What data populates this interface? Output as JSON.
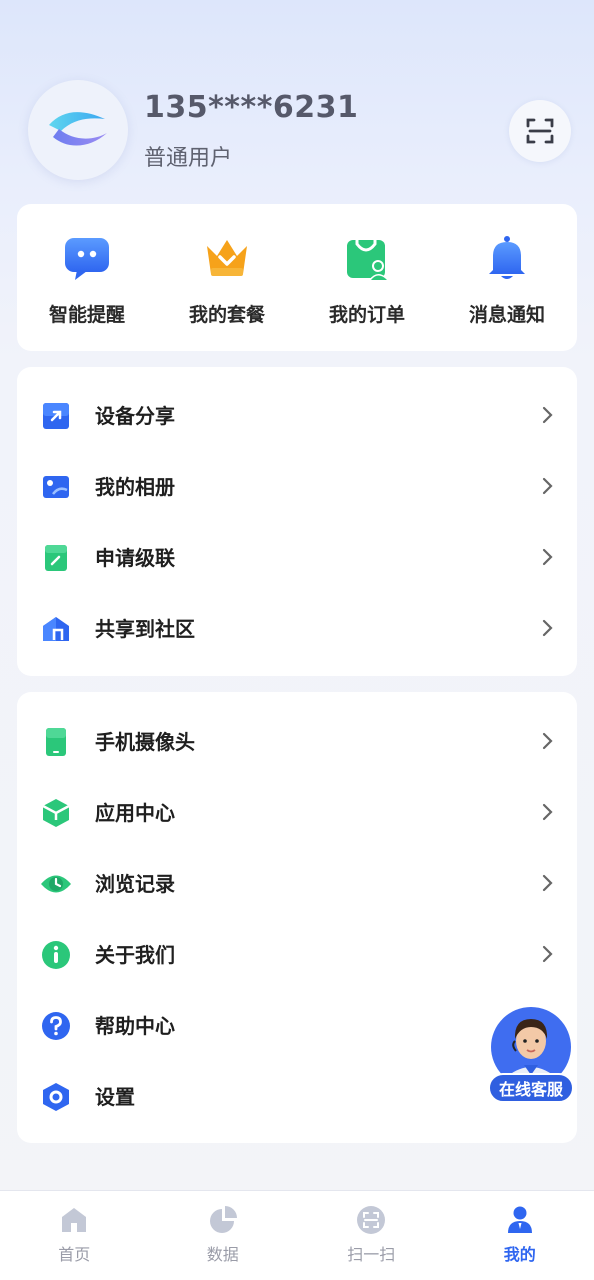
{
  "profile": {
    "phone": "135****6231",
    "user_type": "普通用户"
  },
  "quick_actions": [
    {
      "label": "智能提醒",
      "icon": "chat-bubble-icon"
    },
    {
      "label": "我的套餐",
      "icon": "crown-icon"
    },
    {
      "label": "我的订单",
      "icon": "shopping-bag-icon"
    },
    {
      "label": "消息通知",
      "icon": "bell-icon"
    }
  ],
  "menu_group_1": [
    {
      "label": "设备分享",
      "icon": "share-arrow-icon"
    },
    {
      "label": "我的相册",
      "icon": "photo-album-icon"
    },
    {
      "label": "申请级联",
      "icon": "edit-doc-icon"
    },
    {
      "label": "共享到社区",
      "icon": "community-icon"
    }
  ],
  "menu_group_2": [
    {
      "label": "手机摄像头",
      "icon": "phone-icon"
    },
    {
      "label": "应用中心",
      "icon": "cube-icon"
    },
    {
      "label": "浏览记录",
      "icon": "eye-clock-icon"
    },
    {
      "label": "关于我们",
      "icon": "info-icon"
    },
    {
      "label": "帮助中心",
      "icon": "help-icon"
    },
    {
      "label": "设置",
      "icon": "settings-hex-icon"
    }
  ],
  "customer_service": {
    "label": "在线客服"
  },
  "tabbar": [
    {
      "label": "首页",
      "icon": "home-icon"
    },
    {
      "label": "数据",
      "icon": "pie-chart-icon"
    },
    {
      "label": "扫一扫",
      "icon": "scan-icon"
    },
    {
      "label": "我的",
      "icon": "user-icon",
      "active": true
    }
  ],
  "colors": {
    "accent": "#2f66f0",
    "green": "#2bc77a",
    "blue": "#3b82f6",
    "orange": "#f6a21a"
  }
}
